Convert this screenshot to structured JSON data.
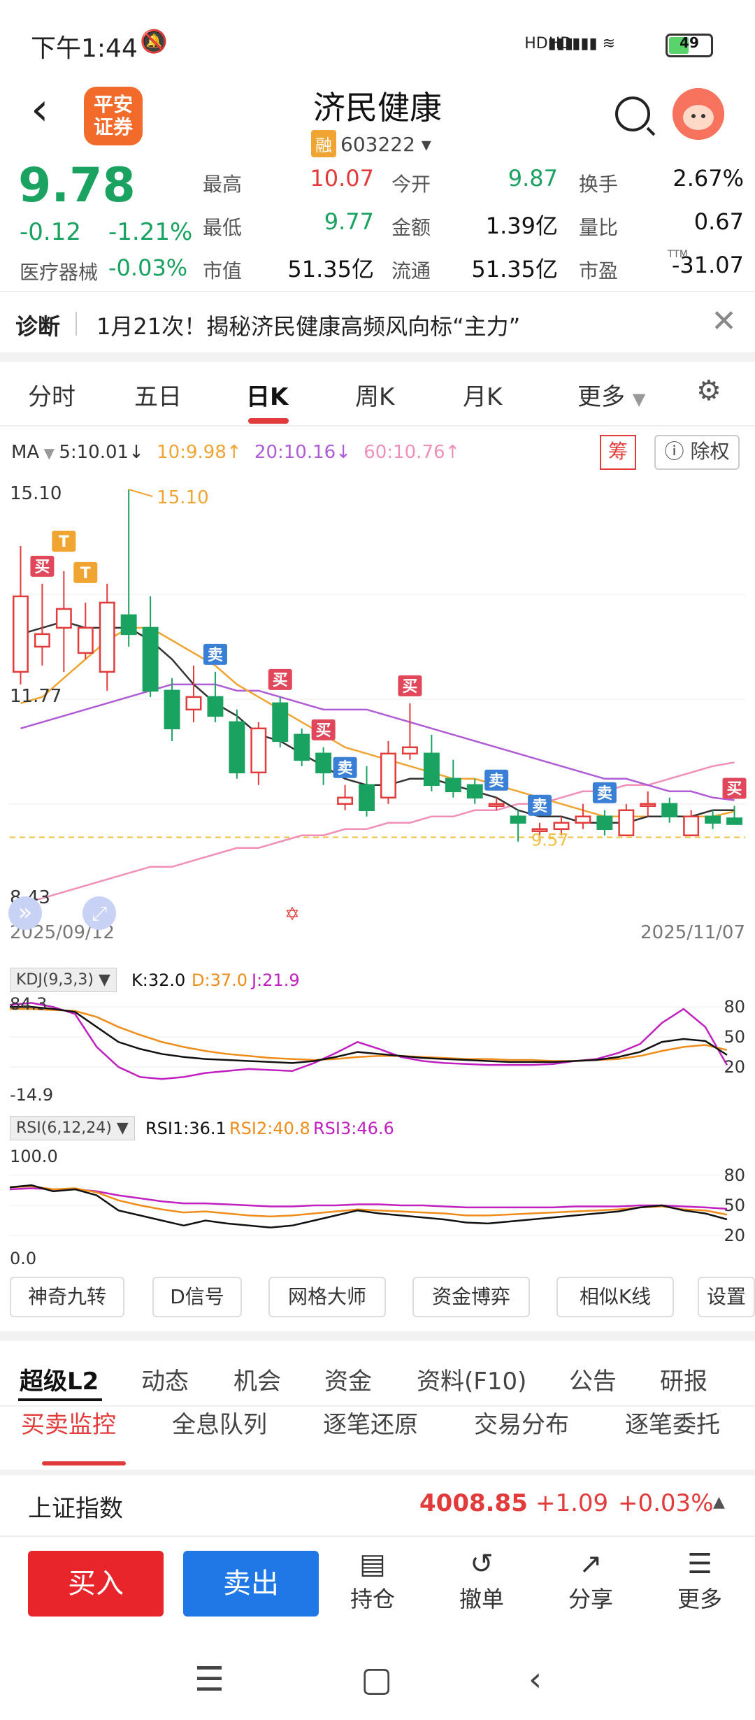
{
  "status_bar": {
    "time": "下午1:44",
    "battery": "49",
    "net1": "HD",
    "net2": "HD"
  },
  "header": {
    "title": "济民健康",
    "rong": "融",
    "code": "603222",
    "logo_line1": "平安",
    "logo_line2": "证券"
  },
  "quote": {
    "price": "9.78",
    "change": "-0.12",
    "change_pct": "-1.21%",
    "industry": "医疗器械",
    "industry_pct": "-0.03%",
    "fields": [
      {
        "label": "最高",
        "value": "10.07",
        "color": "red"
      },
      {
        "label": "今开",
        "value": "9.87",
        "color": "green"
      },
      {
        "label": "换手",
        "value": "2.67%",
        "color": "black"
      },
      {
        "label": "最低",
        "value": "9.77",
        "color": "green"
      },
      {
        "label": "金额",
        "value": "1.39亿",
        "color": "black"
      },
      {
        "label": "量比",
        "value": "0.67",
        "color": "black"
      },
      {
        "label": "市值",
        "value": "51.35亿",
        "color": "black"
      },
      {
        "label": "流通",
        "value": "51.35亿",
        "color": "black"
      },
      {
        "label": "市盈",
        "value": "-31.07",
        "color": "black"
      }
    ],
    "ttm": "TTM"
  },
  "diagnosis": {
    "label": "诊断",
    "text": "1月21次！揭秘济民健康高频风向标“主力”"
  },
  "period_tabs": [
    "分时",
    "五日",
    "日K",
    "周K",
    "月K",
    "更多"
  ],
  "ma_legend": {
    "name": "MA",
    "ma5": "5:10.01↓",
    "ma10": "10:9.98↑",
    "ma20": "20:10.16↓",
    "ma60": "60:10.76↑"
  },
  "chart_buttons": {
    "chou": "筹",
    "chuquan": "除权"
  },
  "chart_data": {
    "type": "candlestick",
    "y_labels": [
      "15.10",
      "11.77",
      "8.43"
    ],
    "max_label": "15.10",
    "last_label": "9.57",
    "x_labels": [
      "2025/09/12",
      "2025/11/07"
    ],
    "ylim": [
      8.43,
      15.1
    ],
    "candles": [
      {
        "o": 12.2,
        "c": 13.4,
        "h": 14.2,
        "l": 12.0
      },
      {
        "o": 12.6,
        "c": 12.8,
        "h": 13.6,
        "l": 12.3
      },
      {
        "o": 12.9,
        "c": 13.2,
        "h": 13.8,
        "l": 12.2
      },
      {
        "o": 12.5,
        "c": 12.9,
        "h": 13.3,
        "l": 12.4
      },
      {
        "o": 12.2,
        "c": 13.3,
        "h": 13.6,
        "l": 11.9
      },
      {
        "o": 13.1,
        "c": 12.8,
        "h": 15.1,
        "l": 12.6
      },
      {
        "o": 12.9,
        "c": 11.9,
        "h": 13.4,
        "l": 11.8
      },
      {
        "o": 11.9,
        "c": 11.3,
        "h": 12.1,
        "l": 11.1
      },
      {
        "o": 11.6,
        "c": 11.8,
        "h": 12.3,
        "l": 11.4
      },
      {
        "o": 11.8,
        "c": 11.5,
        "h": 12.2,
        "l": 11.4
      },
      {
        "o": 11.4,
        "c": 10.6,
        "h": 11.6,
        "l": 10.5
      },
      {
        "o": 10.6,
        "c": 11.3,
        "h": 11.4,
        "l": 10.4
      },
      {
        "o": 11.7,
        "c": 11.1,
        "h": 11.8,
        "l": 11.0
      },
      {
        "o": 11.2,
        "c": 10.8,
        "h": 11.3,
        "l": 10.7
      },
      {
        "o": 10.9,
        "c": 10.6,
        "h": 11.0,
        "l": 10.4
      },
      {
        "o": 10.1,
        "c": 10.2,
        "h": 10.4,
        "l": 10.0
      },
      {
        "o": 10.4,
        "c": 10.0,
        "h": 10.7,
        "l": 9.9
      },
      {
        "o": 10.2,
        "c": 10.9,
        "h": 11.1,
        "l": 10.1
      },
      {
        "o": 10.9,
        "c": 11.0,
        "h": 11.7,
        "l": 10.8
      },
      {
        "o": 10.9,
        "c": 10.4,
        "h": 11.2,
        "l": 10.3
      },
      {
        "o": 10.5,
        "c": 10.3,
        "h": 10.8,
        "l": 10.2
      },
      {
        "o": 10.4,
        "c": 10.2,
        "h": 10.5,
        "l": 10.1
      },
      {
        "o": 10.1,
        "c": 10.1,
        "h": 10.2,
        "l": 10.0
      },
      {
        "o": 9.9,
        "c": 9.8,
        "h": 10.0,
        "l": 9.5
      },
      {
        "o": 9.7,
        "c": 9.7,
        "h": 9.8,
        "l": 9.6
      },
      {
        "o": 9.7,
        "c": 9.8,
        "h": 9.9,
        "l": 9.6
      },
      {
        "o": 9.8,
        "c": 9.9,
        "h": 10.1,
        "l": 9.7
      },
      {
        "o": 9.9,
        "c": 9.7,
        "h": 10.0,
        "l": 9.6
      },
      {
        "o": 9.6,
        "c": 10.0,
        "h": 10.1,
        "l": 9.6
      },
      {
        "o": 10.1,
        "c": 10.1,
        "h": 10.3,
        "l": 9.9
      },
      {
        "o": 10.1,
        "c": 9.9,
        "h": 10.2,
        "l": 9.8
      },
      {
        "o": 9.6,
        "c": 9.9,
        "h": 10.0,
        "l": 9.6
      },
      {
        "o": 9.9,
        "c": 9.8,
        "h": 10.0,
        "l": 9.7
      },
      {
        "o": 9.87,
        "c": 9.78,
        "h": 10.07,
        "l": 9.77
      }
    ],
    "ma5": [
      12.8,
      12.9,
      13.0,
      12.9,
      12.9,
      12.9,
      12.7,
      12.4,
      12.0,
      11.7,
      11.5,
      11.2,
      11.1,
      10.9,
      10.7,
      10.5,
      10.4,
      10.4,
      10.5,
      10.5,
      10.4,
      10.3,
      10.2,
      10.0,
      9.9,
      9.9,
      9.8,
      9.8,
      9.8,
      9.9,
      9.9,
      9.9,
      10.0,
      10.0
    ],
    "ma10": [
      11.7,
      11.8,
      12.1,
      12.4,
      12.7,
      12.9,
      12.9,
      12.7,
      12.5,
      12.3,
      12.0,
      11.8,
      11.6,
      11.4,
      11.2,
      11.0,
      10.9,
      10.8,
      10.7,
      10.6,
      10.5,
      10.5,
      10.4,
      10.3,
      10.2,
      10.1,
      10.0,
      9.9,
      9.9,
      9.9,
      9.9,
      9.9,
      9.9,
      9.98
    ],
    "ma20": [
      11.3,
      11.4,
      11.5,
      11.6,
      11.7,
      11.8,
      11.9,
      12.0,
      12.0,
      12.0,
      11.9,
      11.9,
      11.8,
      11.7,
      11.6,
      11.6,
      11.6,
      11.5,
      11.4,
      11.3,
      11.2,
      11.1,
      11.0,
      10.9,
      10.8,
      10.7,
      10.6,
      10.5,
      10.5,
      10.4,
      10.3,
      10.3,
      10.2,
      10.16
    ],
    "ma60": [
      8.5,
      8.6,
      8.7,
      8.8,
      8.9,
      9.0,
      9.1,
      9.1,
      9.2,
      9.3,
      9.4,
      9.4,
      9.5,
      9.6,
      9.6,
      9.7,
      9.7,
      9.8,
      9.8,
      9.9,
      9.9,
      10.0,
      10.0,
      10.1,
      10.1,
      10.2,
      10.3,
      10.3,
      10.4,
      10.4,
      10.5,
      10.6,
      10.7,
      10.76
    ],
    "signals": [
      {
        "i": 1,
        "text": "买",
        "type": "buy"
      },
      {
        "i": 2,
        "text": "T",
        "type": "t"
      },
      {
        "i": 3,
        "text": "T",
        "type": "t"
      },
      {
        "i": 9,
        "text": "卖",
        "type": "sell"
      },
      {
        "i": 12,
        "text": "买",
        "type": "buy"
      },
      {
        "i": 14,
        "text": "买",
        "type": "buy"
      },
      {
        "i": 15,
        "text": "卖",
        "type": "sell"
      },
      {
        "i": 18,
        "text": "买",
        "type": "buy"
      },
      {
        "i": 22,
        "text": "卖",
        "type": "sell"
      },
      {
        "i": 24,
        "text": "卖",
        "type": "sell"
      },
      {
        "i": 27,
        "text": "卖",
        "type": "sell"
      },
      {
        "i": 33,
        "text": "买",
        "type": "buy"
      }
    ]
  },
  "kdj": {
    "label": "KDJ(9,3,3)",
    "k": "K:32.0",
    "d": "D:37.0",
    "j": "J:21.9",
    "top_label": "84.3",
    "bottom_label": "-14.9",
    "right_labels": [
      "80",
      "50",
      "20"
    ],
    "ylim": [
      -14.9,
      84.3
    ],
    "K": [
      80,
      80,
      78,
      75,
      60,
      45,
      38,
      33,
      30,
      28,
      27,
      26,
      25,
      24,
      26,
      30,
      35,
      33,
      31,
      29,
      28,
      27,
      26,
      25,
      25,
      25,
      26,
      27,
      30,
      35,
      45,
      48,
      46,
      32
    ],
    "D": [
      78,
      78,
      77,
      76,
      70,
      60,
      52,
      45,
      40,
      36,
      33,
      31,
      29,
      28,
      27,
      28,
      30,
      31,
      31,
      30,
      29,
      28,
      28,
      27,
      27,
      26,
      26,
      27,
      28,
      31,
      36,
      40,
      42,
      37
    ],
    "J": [
      82,
      84,
      80,
      73,
      40,
      20,
      10,
      8,
      10,
      14,
      16,
      18,
      17,
      16,
      24,
      34,
      45,
      38,
      30,
      26,
      24,
      23,
      22,
      22,
      22,
      23,
      26,
      28,
      34,
      43,
      64,
      78,
      60,
      21.9
    ]
  },
  "rsi": {
    "label": "RSI(6,12,24)",
    "rsi1": "RSI1:36.1",
    "rsi2": "RSI2:40.8",
    "rsi3": "RSI3:46.6",
    "top_label": "100.0",
    "bottom_label": "0.0",
    "right_labels": [
      "80",
      "50",
      "20"
    ],
    "R1": [
      68,
      70,
      64,
      66,
      60,
      45,
      40,
      35,
      30,
      35,
      32,
      30,
      28,
      30,
      35,
      40,
      45,
      42,
      40,
      38,
      36,
      33,
      32,
      34,
      36,
      38,
      40,
      42,
      44,
      48,
      50,
      45,
      42,
      36.1
    ],
    "R2": [
      68,
      69,
      66,
      67,
      63,
      55,
      50,
      46,
      43,
      44,
      42,
      40,
      39,
      40,
      42,
      44,
      46,
      45,
      44,
      43,
      42,
      40,
      40,
      41,
      42,
      43,
      44,
      45,
      46,
      48,
      49,
      46,
      45,
      40.8
    ],
    "R3": [
      66,
      67,
      66,
      66,
      64,
      60,
      57,
      54,
      52,
      52,
      51,
      50,
      49,
      49,
      50,
      50,
      51,
      51,
      50,
      50,
      49,
      48,
      48,
      48,
      48,
      48,
      49,
      49,
      49,
      50,
      50,
      49,
      48,
      46.6
    ]
  },
  "tools": [
    "神奇九转",
    "D信号",
    "网格大师",
    "资金博弈",
    "相似K线",
    "设置"
  ],
  "info_tabs": [
    "超级L2",
    "动态",
    "机会",
    "资金",
    "资料(F10)",
    "公告",
    "研报"
  ],
  "sub_tabs": [
    "买卖监控",
    "全息队列",
    "逐笔还原",
    "交易分布",
    "逐笔委托"
  ],
  "index_bar": {
    "name": "上证指数",
    "value": "4008.85",
    "change": "+1.09",
    "pct": "+0.03%"
  },
  "actions": {
    "buy": "买入",
    "sell": "卖出",
    "items": [
      {
        "label": "持仓",
        "icon": "▤"
      },
      {
        "label": "撤单",
        "icon": "↺"
      },
      {
        "label": "分享",
        "icon": "↗"
      },
      {
        "label": "更多",
        "icon": "☰"
      }
    ]
  },
  "colors": {
    "up": "#e23b3b",
    "down": "#1aa260",
    "ma5": "#333333",
    "ma10": "#f0a533",
    "ma20": "#b05cd6",
    "ma60": "#f08fb8"
  }
}
